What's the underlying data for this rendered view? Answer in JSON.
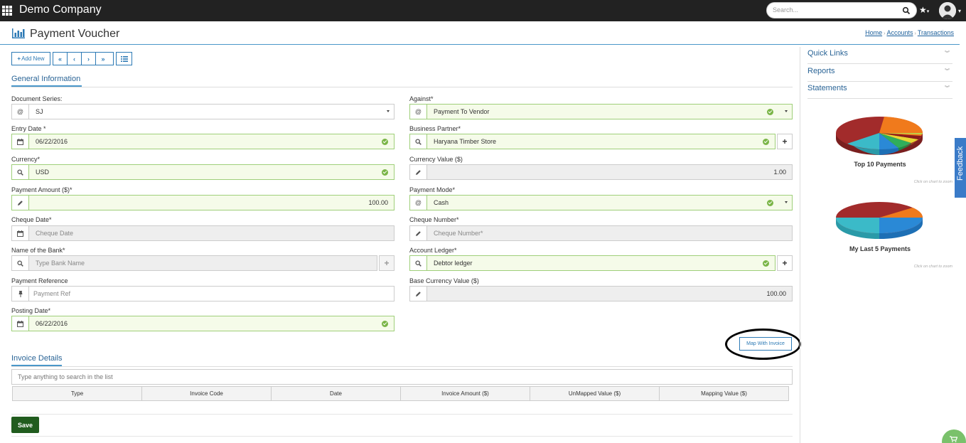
{
  "app": {
    "company": "Demo Company",
    "search_placeholder": "Search..."
  },
  "page": {
    "title": "Payment Voucher"
  },
  "breadcrumb": [
    "Home",
    "Accounts",
    "Transactions"
  ],
  "toolbar": {
    "add_new": "Add New"
  },
  "general": {
    "title": "General Information",
    "document_series": {
      "label": "Document Series:",
      "value": "SJ"
    },
    "against": {
      "label": "Against*",
      "value": "Payment To Vendor"
    },
    "entry_date": {
      "label": "Entry Date *",
      "value": "06/22/2016"
    },
    "business_partner": {
      "label": "Business Partner*",
      "value": "Haryana Timber Store"
    },
    "currency": {
      "label": "Currency*",
      "value": "USD"
    },
    "currency_value": {
      "label": "Currency Value ($)",
      "value": "1.00"
    },
    "payment_amount": {
      "label": "Payment Amount ($)*",
      "value": "100.00"
    },
    "payment_mode": {
      "label": "Payment Mode*",
      "value": "Cash"
    },
    "cheque_date": {
      "label": "Cheque Date*",
      "placeholder": "Cheque Date"
    },
    "cheque_number": {
      "label": "Cheque Number*",
      "placeholder": "Cheque Number*"
    },
    "bank_name": {
      "label": "Name of the Bank*",
      "placeholder": "Type Bank Name"
    },
    "account_ledger": {
      "label": "Account Ledger*",
      "value": "Debtor ledger"
    },
    "payment_reference": {
      "label": "Payment Reference",
      "placeholder": "Payment Ref"
    },
    "base_currency_value": {
      "label": "Base Currency Value ($)",
      "value": "100.00"
    },
    "posting_date": {
      "label": "Posting Date*",
      "value": "06/22/2016"
    }
  },
  "map_button": "Map With Invoice",
  "invoice": {
    "title": "Invoice Details",
    "search_placeholder": "Type anything to search in the list",
    "columns": [
      "Type",
      "Invoice Code",
      "Date",
      "Invoice Amount ($)",
      "UnMapped Value ($)",
      "Mapping Value ($)"
    ]
  },
  "save_label": "Save",
  "sidebar": {
    "quick_links": "Quick Links",
    "reports": "Reports",
    "statements": "Statements",
    "chart1_title": "Top 10 Payments",
    "chart2_title": "My Last 5 Payments",
    "chart_hint": "Click on chart to zoom"
  },
  "feedback_label": "Feedback",
  "colors": {
    "topbar": "#222222",
    "accent": "#2d7ab5",
    "valid_border": "#9fcf7a",
    "save": "#215c1e"
  }
}
